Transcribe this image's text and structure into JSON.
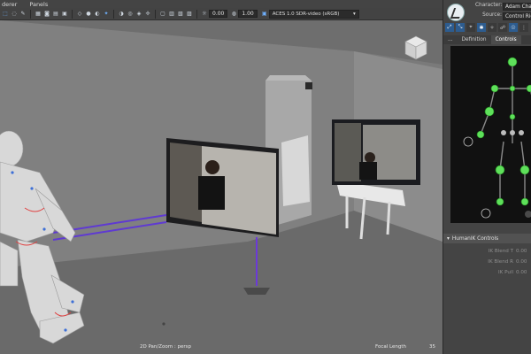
{
  "menu": {
    "items": [
      "derer",
      "Panels"
    ]
  },
  "toolbar": {
    "exposure_value": "0.00",
    "gamma_value": "1.00",
    "color_space": "ACES 1.0 SDR-video (sRGB)",
    "icons": [
      "select-icon",
      "lasso-icon",
      "paint-icon",
      "grid-icon",
      "camera-icon",
      "bookmark-icon",
      "film-icon",
      "wireframe-icon",
      "smooth-shade-icon",
      "textured-icon",
      "light-icon",
      "shadow-icon",
      "isolate-icon",
      "xray-icon",
      "xray-joints-icon",
      "resolution-gate-icon",
      "gate-mask-icon",
      "field-chart-icon",
      "safe-action-icon",
      "exposure-icon"
    ]
  },
  "viewport": {
    "camera_label": "2D Pan/Zoom : persp",
    "focal_label": "Focal Length",
    "focal_value": "35"
  },
  "panel": {
    "character_label": "Character:",
    "character_value": "Adam Chara",
    "source_label": "Source:",
    "source_value": "Control Rig",
    "tabs": [
      "...",
      "Definition",
      "Controls"
    ],
    "active_tab": "Controls",
    "section_title": "HumanIK Controls",
    "rows": [
      {
        "label": "IK Blend T",
        "value": "0.00"
      },
      {
        "label": "IK Blend R",
        "value": "0.00"
      },
      {
        "label": "IK Pull",
        "value": "0.00"
      }
    ]
  }
}
